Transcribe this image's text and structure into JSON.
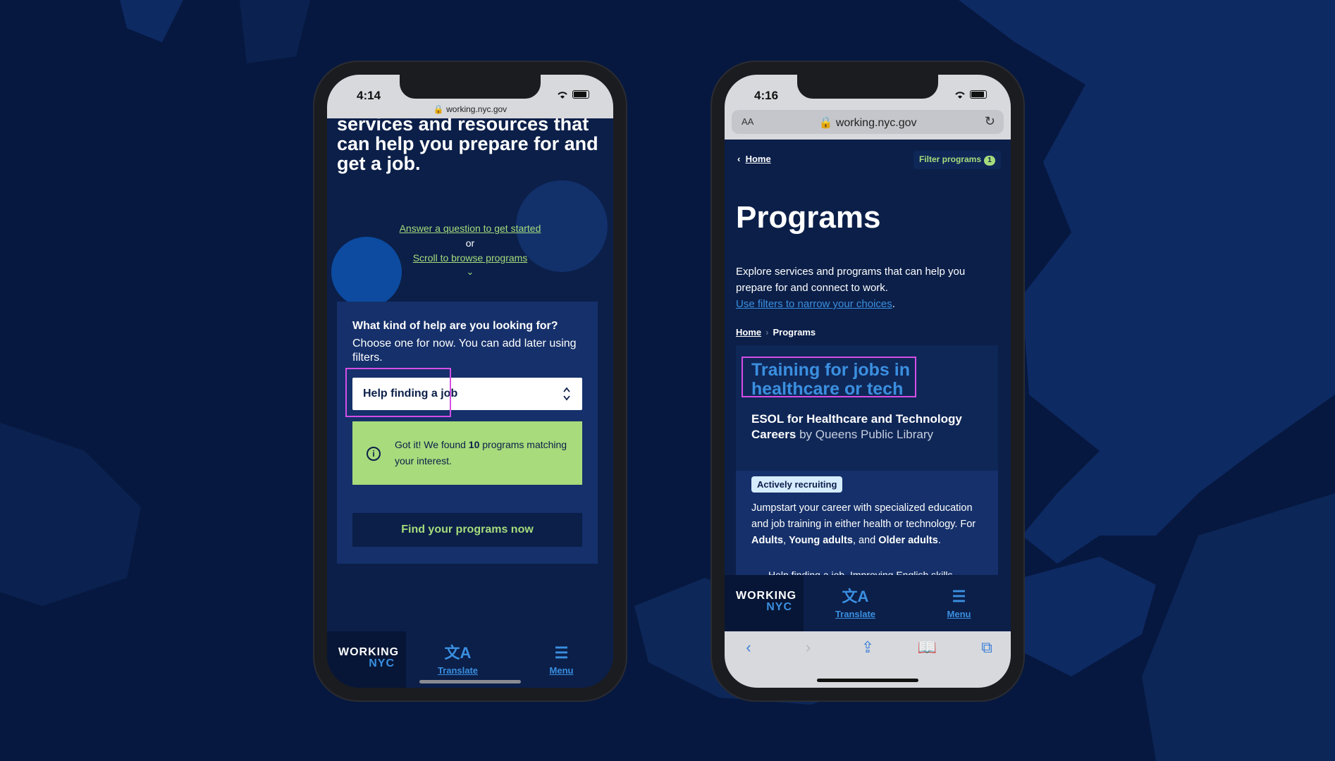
{
  "phone1": {
    "status": {
      "time": "4:14"
    },
    "url": "working.nyc.gov",
    "hero_text": "services and resources that can help you prepare for and get a job.",
    "link_answer": "Answer a question to get started",
    "or_text": "or",
    "link_scroll": "Scroll to browse programs",
    "question": "What kind of help are you looking for?",
    "question_sub": "Choose one for now. You can add later using filters.",
    "select_value": "Help finding a job",
    "notice_pre": "Got it! We found ",
    "notice_count": "10",
    "notice_post": " programs matching your interest.",
    "cta": "Find your programs now",
    "nav": {
      "logo_line1": "WORKING",
      "logo_line2": "NYC",
      "translate": "Translate",
      "menu": "Menu"
    }
  },
  "phone2": {
    "status": {
      "time": "4:16"
    },
    "aa": "AA",
    "url": "working.nyc.gov",
    "back_home": "Home",
    "filter_label": "Filter programs",
    "filter_count": "1",
    "title": "Programs",
    "desc": "Explore services and programs that can help you prepare for and connect to work.",
    "desc_link": "Use filters to narrow your choices",
    "crumb_home": "Home",
    "crumb_current": "Programs",
    "program": {
      "tag": "Training for jobs in healthcare or tech",
      "name": "ESOL for Healthcare and Technology Careers",
      "by": "by Queens Public Library",
      "badge": "Actively recruiting",
      "body": "Jumpstart your career with specialized education and job training in either health or technology. For",
      "aud1": "Adults",
      "aud2": "Young adults",
      "aud3": "Older adults",
      "cut": "Help finding a job, Improving English skills"
    },
    "nav": {
      "logo_line1": "WORKING",
      "logo_line2": "NYC",
      "translate": "Translate",
      "menu": "Menu"
    }
  },
  "colors": {
    "background": "#06183f",
    "accent_green": "#a6dc7c",
    "accent_blue": "#3b8fe0",
    "highlight": "#d54ee6"
  }
}
